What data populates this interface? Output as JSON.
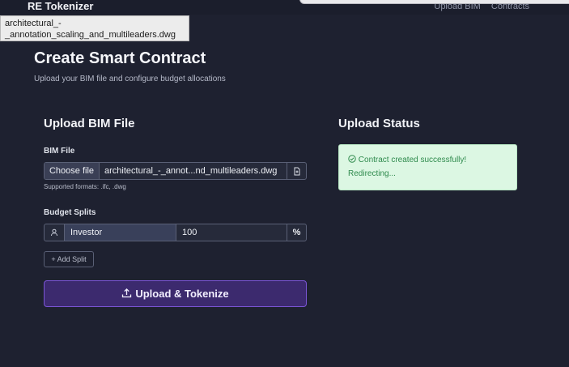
{
  "app": {
    "title": "RE Tokenizer"
  },
  "nav": {
    "items": [
      "Upload BIM",
      "Contracts"
    ]
  },
  "tooltip": {
    "text_line1": "architectural_-",
    "text_line2": "_annotation_scaling_and_multileaders.dwg"
  },
  "page": {
    "title": "Create Smart Contract",
    "subtitle": "Upload your BIM file and configure budget allocations"
  },
  "upload": {
    "card_title": "Upload BIM File",
    "file_label": "BIM File",
    "choose_label": "Choose file",
    "file_name": "architectural_-_annot...nd_multileaders.dwg",
    "file_icon": "file-icon",
    "hint": "Supported formats: .ifc, .dwg",
    "splits_label": "Budget Splits",
    "splits": [
      {
        "icon": "person-icon",
        "name": "Investor",
        "value": "100",
        "unit": "%"
      }
    ],
    "add_split_label": "+ Add Split",
    "submit_label": "Upload & Tokenize",
    "submit_icon": "upload-icon"
  },
  "status": {
    "card_title": "Upload Status",
    "message_line1": "Contract created successfully!",
    "message_line2": "Redirecting...",
    "icon": "check-circle-icon",
    "bg_color": "#dcf7e3",
    "text_color": "#2f8a4d"
  },
  "colors": {
    "background": "#1e2130",
    "accent": "#7b55d6"
  }
}
